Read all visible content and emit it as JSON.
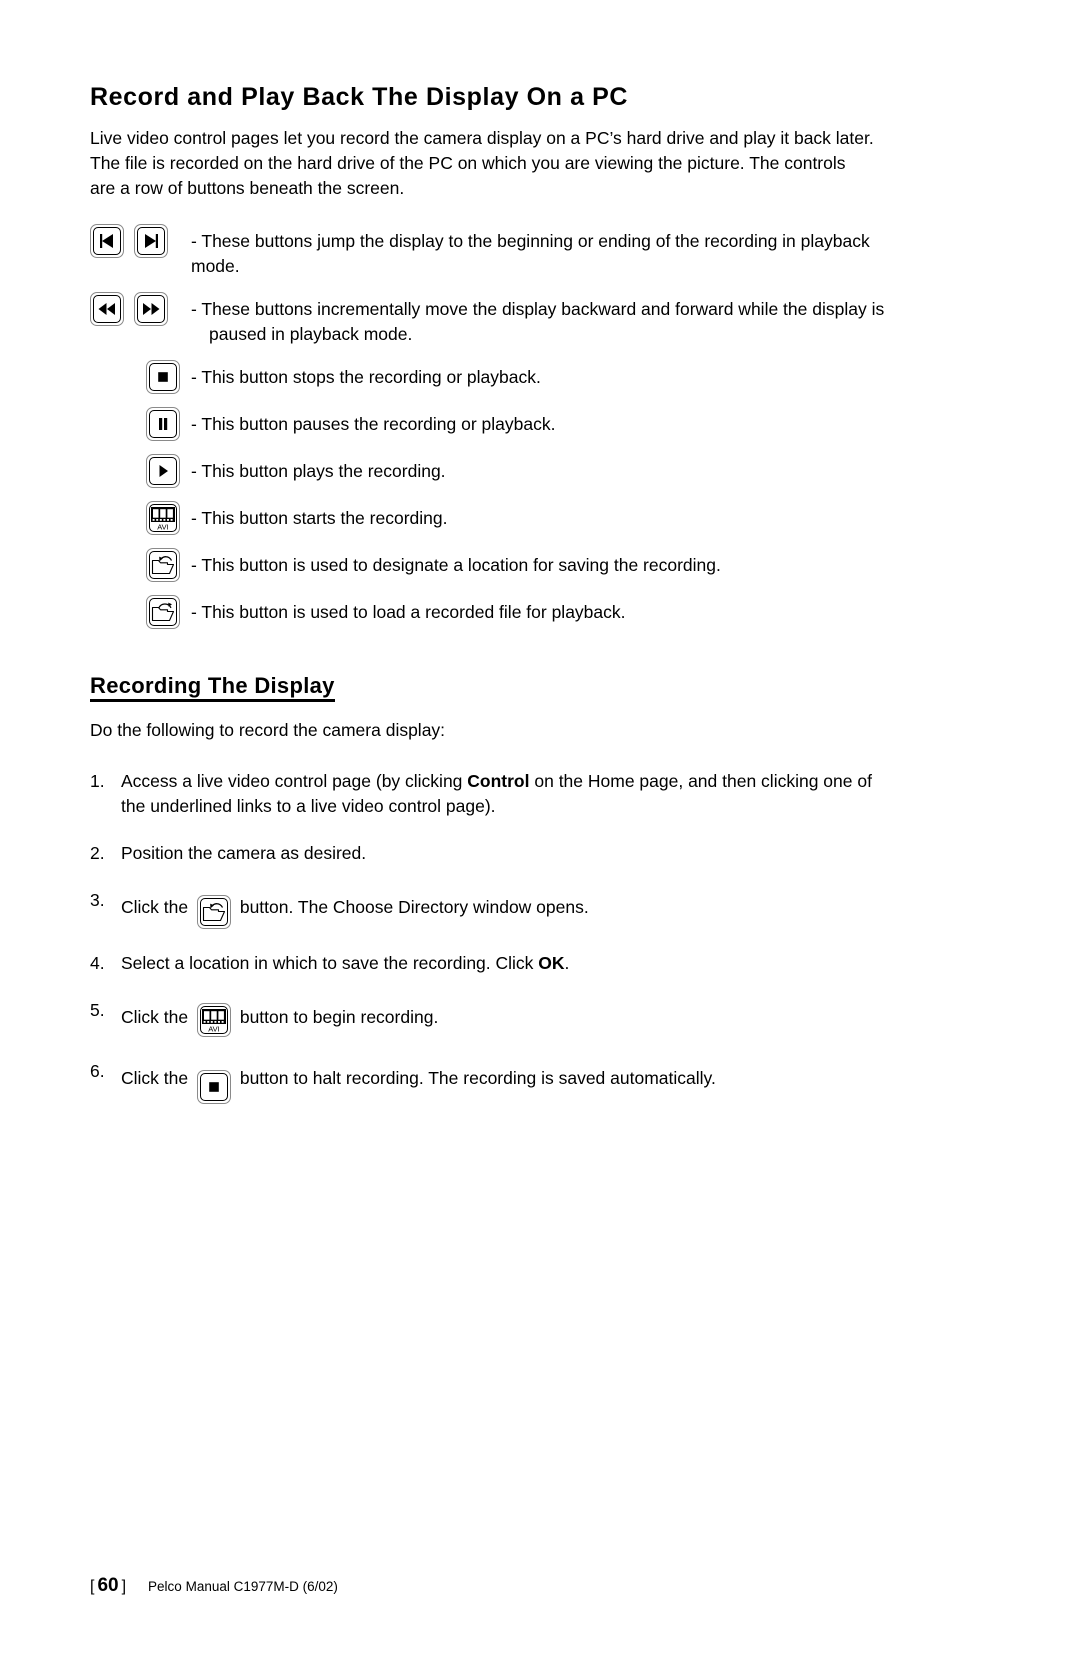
{
  "page": {
    "title": "Record and Play Back The Display On a PC",
    "intro": "Live video control pages let you record the camera display on a PC’s hard drive and play it back later. The file is recorded on the hard drive of the PC on which you are viewing the picture. The controls are a row of buttons beneath the screen."
  },
  "legend": [
    {
      "icons": [
        "skip-to-start-icon",
        "skip-to-end-icon"
      ],
      "dash": "-",
      "text": "These buttons jump the display to the beginning or ending of the recording in playback mode.",
      "continuation": ""
    },
    {
      "icons": [
        "rewind-icon",
        "fast-forward-icon"
      ],
      "dash": "-",
      "text": "These buttons incrementally move the display backward and forward while the display is",
      "continuation": "paused in playback mode."
    },
    {
      "icons": [
        "stop-icon"
      ],
      "dash": "-",
      "text": "This button stops the recording or playback.",
      "continuation": ""
    },
    {
      "icons": [
        "pause-icon"
      ],
      "dash": "-",
      "text": "This button pauses the recording or playback.",
      "continuation": ""
    },
    {
      "icons": [
        "play-icon"
      ],
      "dash": "-",
      "text": "This button plays the recording.",
      "continuation": ""
    },
    {
      "icons": [
        "avi-record-icon"
      ],
      "dash": "-",
      "text": "This button starts the recording.",
      "continuation": ""
    },
    {
      "icons": [
        "save-folder-icon"
      ],
      "dash": "-",
      "text": "This button is used to designate a location for saving the recording.",
      "continuation": ""
    },
    {
      "icons": [
        "open-folder-icon"
      ],
      "dash": "-",
      "text": "This button is used to load a recorded file for playback.",
      "continuation": ""
    }
  ],
  "section": {
    "heading": "Recording The Display",
    "lead": "Do the following to record the camera display:"
  },
  "steps": [
    {
      "num": "1.",
      "pre": "Access a live video control page (by clicking ",
      "bold": "Control",
      "post": " on the Home page, and then clicking one of the underlined links to a live video control page).",
      "icon": ""
    },
    {
      "num": "2.",
      "pre": "Position the camera as desired.",
      "bold": "",
      "post": "",
      "icon": ""
    },
    {
      "num": "3.",
      "pre": "Click the ",
      "bold": "",
      "post": " button. The Choose Directory window opens.",
      "icon": "save-folder-icon"
    },
    {
      "num": "4.",
      "pre": "Select a location in which to save the recording. Click ",
      "bold": "OK",
      "post": ".",
      "icon": ""
    },
    {
      "num": "5.",
      "pre": "Click the ",
      "bold": "",
      "post": " button to begin recording.",
      "icon": "avi-record-icon"
    },
    {
      "num": "6.",
      "pre": "Click the ",
      "bold": "",
      "post": " button to halt recording. The recording is saved automatically.",
      "icon": "stop-icon"
    }
  ],
  "avi_label": "AVI",
  "footer": {
    "bracket_open": "[",
    "page_number": "60",
    "bracket_close": "]",
    "manual": "Pelco Manual C1977M-D (6/02)"
  },
  "colors": {
    "text": "#000000",
    "background": "#ffffff",
    "button_outer_border": "#8a8a8a",
    "button_inner_border": "#000000"
  }
}
